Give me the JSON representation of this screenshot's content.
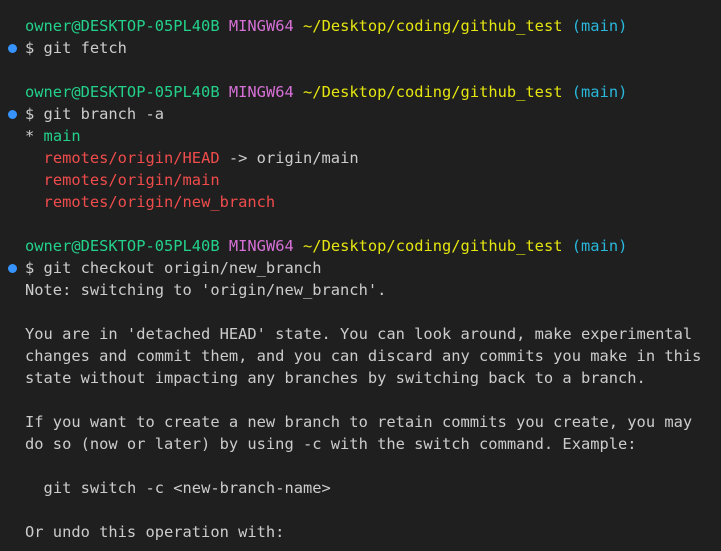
{
  "colors": {
    "background": "#1f1f1f",
    "default_text": "#cccccc",
    "prompt_user": "#23d18b",
    "prompt_env": "#d670d6",
    "prompt_path": "#e5e510",
    "prompt_branch": "#29b8db",
    "current_branch": "#23d18b",
    "remote_branch": "#f14c4c",
    "command_marker": "#3794ff"
  },
  "prompt": {
    "user": "owner@DESKTOP-05PL40B",
    "env": "MINGW64",
    "path": "~/Desktop/coding/github_test",
    "branch": "(main)"
  },
  "commands": [
    {
      "marker_icon": "circle-dot-icon",
      "text": "$ git fetch"
    },
    {
      "marker_icon": "circle-dot-icon",
      "text": "$ git branch -a"
    },
    {
      "marker_icon": "circle-dot-icon",
      "text": "$ git checkout origin/new_branch"
    }
  ],
  "branch_list": {
    "current_prefix": "* ",
    "current": "main",
    "head_ref": "remotes/origin/HEAD",
    "head_arrow": " -> origin/main",
    "remote_main": "remotes/origin/main",
    "remote_new": "remotes/origin/new_branch"
  },
  "checkout_output": {
    "note": "Note: switching to 'origin/new_branch'.",
    "detached_1": "You are in 'detached HEAD' state. You can look around, make experimental",
    "detached_2": "changes and commit them, and you can discard any commits you make in this",
    "detached_3": "state without impacting any branches by switching back to a branch.",
    "create_1": "If you want to create a new branch to retain commits you create, you may",
    "create_2": "do so (now or later) by using -c with the switch command. Example:",
    "example": "git switch -c <new-branch-name>",
    "undo": "Or undo this operation with:"
  }
}
